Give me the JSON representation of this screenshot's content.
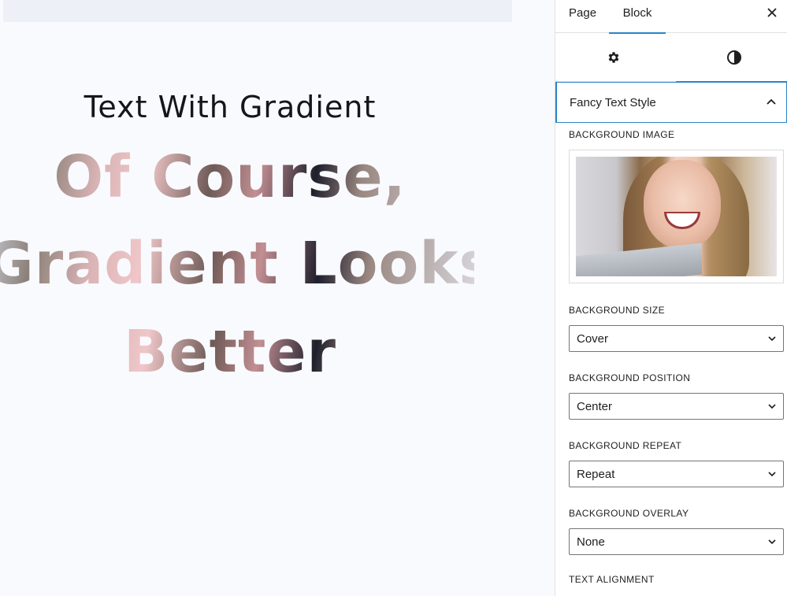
{
  "canvas": {
    "heading_plain": "Text With Gradient",
    "heading_fancy_line1": "Of Course,",
    "heading_fancy_line2": "Gradient Looks",
    "heading_fancy_line3": "Better"
  },
  "sidebar": {
    "tabs": [
      {
        "label": "Page",
        "active": false
      },
      {
        "label": "Block",
        "active": true
      }
    ],
    "close_icon": "close-icon",
    "subtabs": [
      {
        "icon": "gear-icon",
        "active": false
      },
      {
        "icon": "contrast-icon",
        "active": true
      }
    ],
    "panel": {
      "title": "Fancy Text Style",
      "expanded": true,
      "background_image_label": "BACKGROUND IMAGE",
      "fields": [
        {
          "label": "BACKGROUND SIZE",
          "value": "Cover"
        },
        {
          "label": "BACKGROUND POSITION",
          "value": "Center"
        },
        {
          "label": "BACKGROUND REPEAT",
          "value": "Repeat"
        },
        {
          "label": "BACKGROUND OVERLAY",
          "value": "None"
        }
      ],
      "text_alignment_label": "TEXT ALIGNMENT",
      "alignment_options": [
        {
          "icon": "align-left-icon",
          "selected": false
        },
        {
          "icon": "align-center-icon",
          "selected": true
        },
        {
          "icon": "align-right-icon",
          "selected": false
        }
      ]
    }
  },
  "colors": {
    "accent": "#2a85c9",
    "text": "#1e1e1e",
    "selected_button_bg": "#1e1e1e"
  }
}
